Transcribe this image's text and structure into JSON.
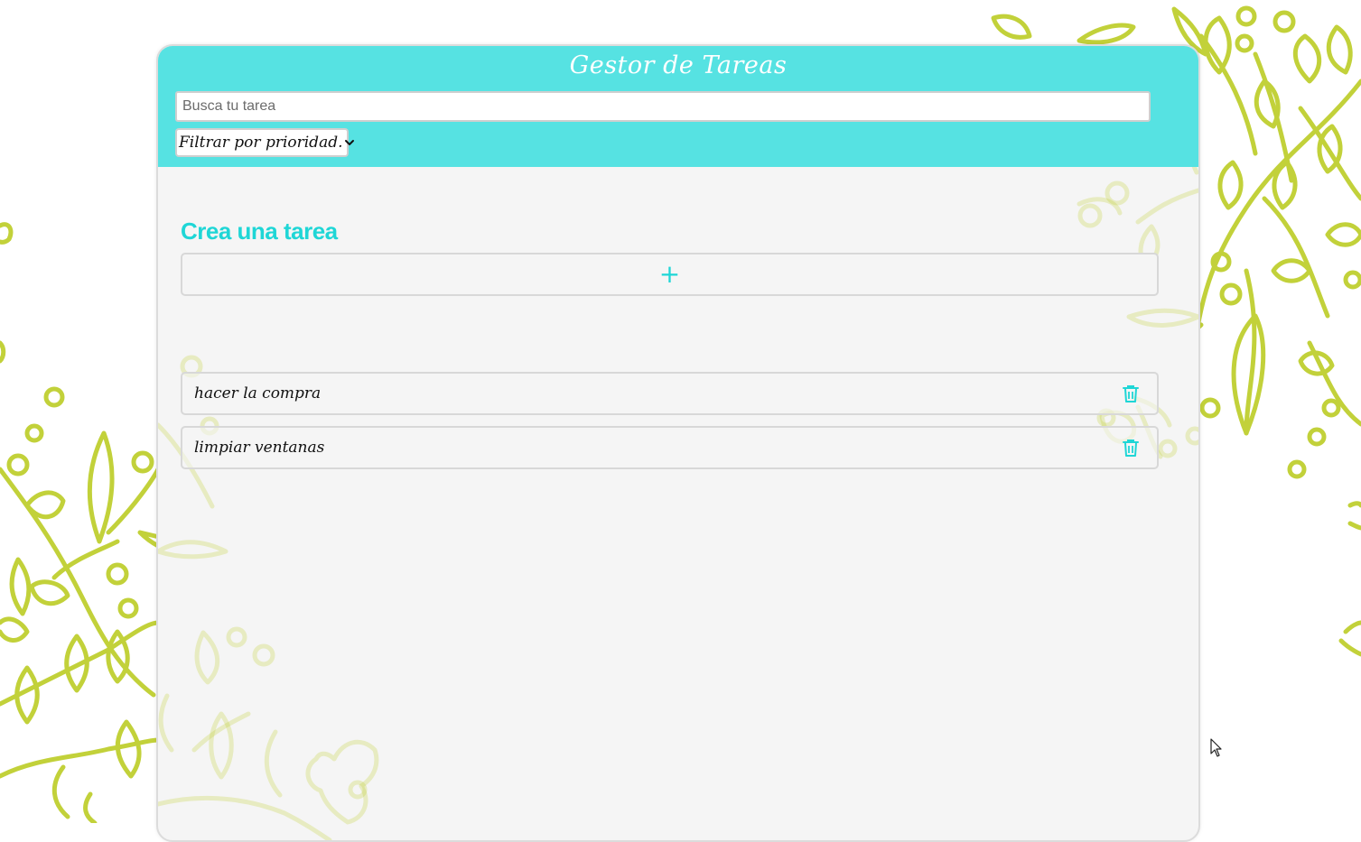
{
  "header": {
    "title": "Gestor de Tareas",
    "search_placeholder": "Busca tu tarea",
    "search_value": "",
    "priority_filter_label": "Filtrar por prioridad."
  },
  "create": {
    "title": "Crea una tarea",
    "add_symbol": "+"
  },
  "tasks": [
    {
      "label": "hacer la compra",
      "action_icon": "trash-icon"
    },
    {
      "label": "limpiar ventanas",
      "action_icon": "trash-icon"
    }
  ],
  "colors": {
    "accent": "#56e2e2",
    "accent_text": "#1fd6d6",
    "card_background": "#f5f5f5",
    "decor_green": "#c2d13a"
  }
}
